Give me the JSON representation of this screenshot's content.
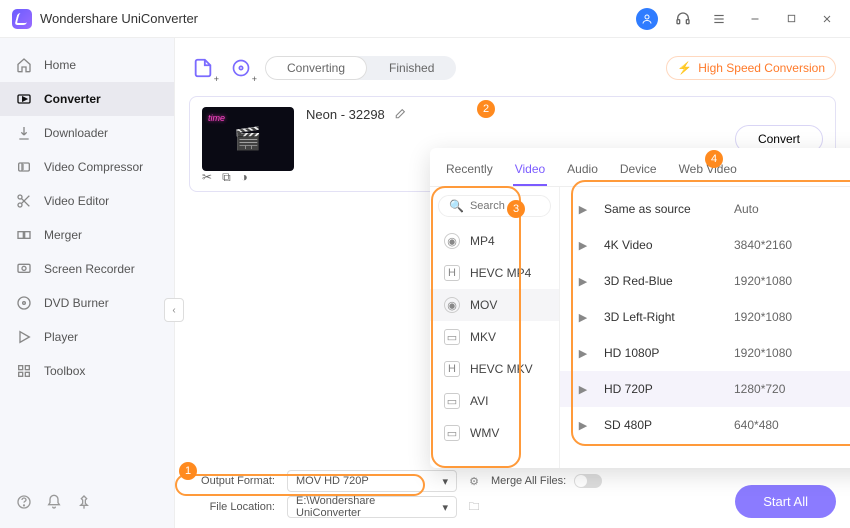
{
  "app": {
    "title": "Wondershare UniConverter"
  },
  "sidebar": {
    "items": [
      {
        "label": "Home"
      },
      {
        "label": "Converter"
      },
      {
        "label": "Downloader"
      },
      {
        "label": "Video Compressor"
      },
      {
        "label": "Video Editor"
      },
      {
        "label": "Merger"
      },
      {
        "label": "Screen Recorder"
      },
      {
        "label": "DVD Burner"
      },
      {
        "label": "Player"
      },
      {
        "label": "Toolbox"
      }
    ]
  },
  "segment": {
    "converting": "Converting",
    "finished": "Finished"
  },
  "hispeed": "High Speed Conversion",
  "clip": {
    "title": "Neon - 32298",
    "convert": "Convert"
  },
  "popover": {
    "tabs": [
      "Recently",
      "Video",
      "Audio",
      "Device",
      "Web Video"
    ],
    "search_placeholder": "Search",
    "formats": [
      "MP4",
      "HEVC MP4",
      "MOV",
      "MKV",
      "HEVC MKV",
      "AVI",
      "WMV"
    ],
    "resolutions": [
      {
        "name": "Same as source",
        "dim": "Auto"
      },
      {
        "name": "4K Video",
        "dim": "3840*2160"
      },
      {
        "name": "3D Red-Blue",
        "dim": "1920*1080"
      },
      {
        "name": "3D Left-Right",
        "dim": "1920*1080"
      },
      {
        "name": "HD 1080P",
        "dim": "1920*1080"
      },
      {
        "name": "HD 720P",
        "dim": "1280*720"
      },
      {
        "name": "SD 480P",
        "dim": "640*480"
      }
    ]
  },
  "footer": {
    "output_label": "Output Format:",
    "output_value": "MOV HD 720P",
    "loc_label": "File Location:",
    "loc_value": "E:\\Wondershare UniConverter",
    "merge_label": "Merge All Files:",
    "start": "Start All"
  },
  "callouts": {
    "n1": "1",
    "n2": "2",
    "n3": "3",
    "n4": "4"
  }
}
